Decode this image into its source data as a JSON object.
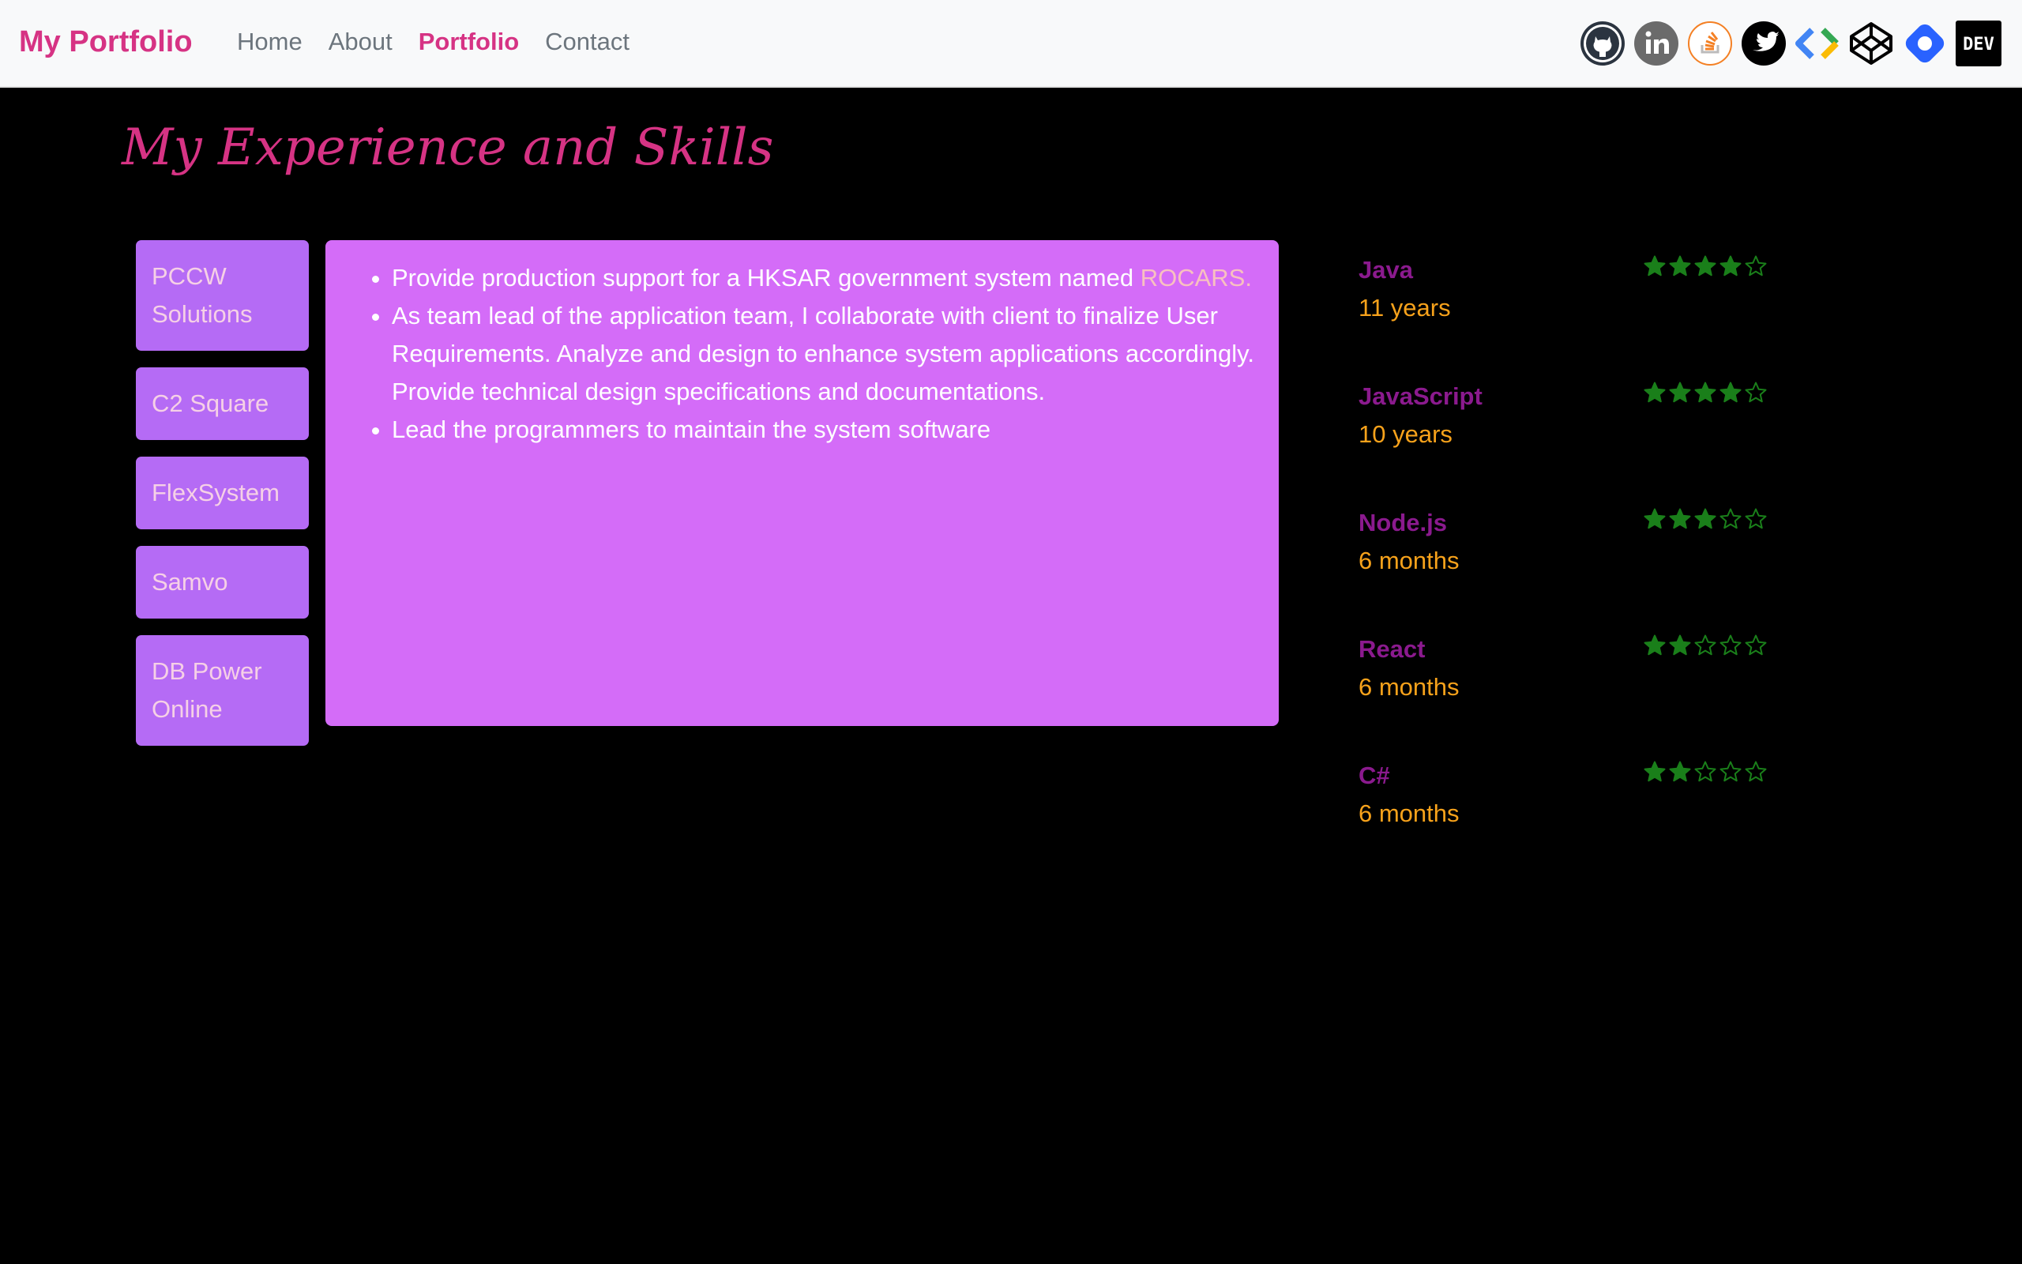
{
  "nav": {
    "brand": "My Portfolio",
    "links": [
      {
        "label": "Home",
        "active": false
      },
      {
        "label": "About",
        "active": false
      },
      {
        "label": "Portfolio",
        "active": true
      },
      {
        "label": "Contact",
        "active": false
      }
    ],
    "social": [
      {
        "icon": "github-icon"
      },
      {
        "icon": "linkedin-icon"
      },
      {
        "icon": "stackoverflow-icon"
      },
      {
        "icon": "twitter-icon"
      },
      {
        "icon": "google-developers-icon"
      },
      {
        "icon": "codepen-icon"
      },
      {
        "icon": "hashnode-icon"
      },
      {
        "icon": "dev-icon",
        "text": "DEV"
      }
    ]
  },
  "page": {
    "title": "My Experience and Skills"
  },
  "companies": [
    {
      "label": "PCCW Solutions",
      "selected": true
    },
    {
      "label": "C2 Square",
      "selected": false
    },
    {
      "label": "FlexSystem",
      "selected": false
    },
    {
      "label": "Samvo",
      "selected": false
    },
    {
      "label": "DB Power Online",
      "selected": false
    }
  ],
  "experience": {
    "item1_text": "Provide production support for a HKSAR government system named ",
    "item1_link": "ROCARS",
    "item1_end": ".",
    "item2": "As team lead of the application team, I collaborate with client to finalize User Requirements. Analyze and design to enhance system applications accordingly. Provide technical design specifications and documentations.",
    "item3": "Lead the programmers to maintain the system software"
  },
  "skills": [
    {
      "name": "Java",
      "duration": "11 years",
      "rating": 4,
      "max": 5
    },
    {
      "name": "JavaScript",
      "duration": "10 years",
      "rating": 4,
      "max": 5
    },
    {
      "name": "Node.js",
      "duration": "6 months",
      "rating": 3,
      "max": 5
    },
    {
      "name": "React",
      "duration": "6 months",
      "rating": 2,
      "max": 5
    },
    {
      "name": "C#",
      "duration": "6 months",
      "rating": 2,
      "max": 5
    }
  ],
  "colors": {
    "brand": "#d63384",
    "tab": "#b56bf5",
    "panel": "#d46cf8",
    "skill_name": "#8b1a8e",
    "skill_years": "#f7a21b",
    "star": "#1a7f1a"
  }
}
